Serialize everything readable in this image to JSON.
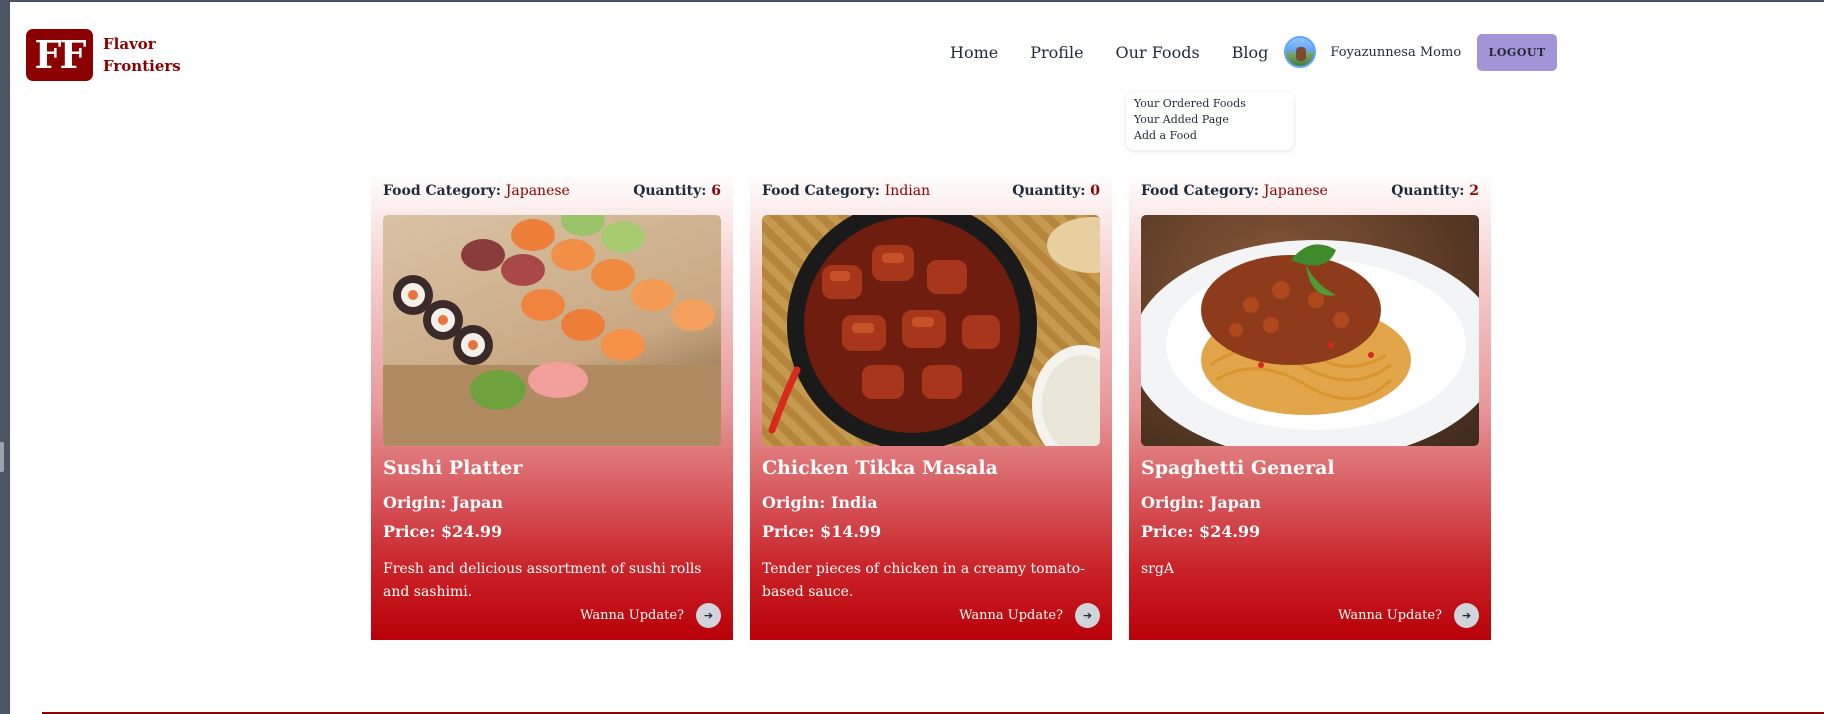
{
  "brand": {
    "logo_letters": "FF",
    "name_line1": "Flavor",
    "name_line2": "Frontiers"
  },
  "nav": {
    "links": [
      "Home",
      "Profile",
      "Our Foods",
      "Blog"
    ],
    "user_name": "Foyazunnesa Momo",
    "logout_label": "LOGOUT"
  },
  "dropdown": {
    "items": [
      "Your Ordered Foods",
      "Your Added Page",
      "Add a Food"
    ]
  },
  "labels": {
    "category": "Food Category:",
    "quantity": "Quantity:",
    "origin": "Origin:",
    "price": "Price:",
    "update": "Wanna Update?"
  },
  "cards": [
    {
      "category": "Japanese",
      "quantity": "6",
      "title": "Sushi Platter",
      "origin": "Japan",
      "price": "$24.99",
      "description": "Fresh and delicious assortment of sushi rolls and sashimi."
    },
    {
      "category": "Indian",
      "quantity": "0",
      "title": "Chicken Tikka Masala",
      "origin": "India",
      "price": "$14.99",
      "description": "Tender pieces of chicken in a creamy tomato-based sauce."
    },
    {
      "category": "Japanese",
      "quantity": "2",
      "title": "Spaghetti General",
      "origin": "Japan",
      "price": "$24.99",
      "description": "srgA"
    }
  ],
  "colors": {
    "brand": "#8b0000",
    "logout_bg": "#a394d8",
    "card_bottom": "#b90008"
  }
}
